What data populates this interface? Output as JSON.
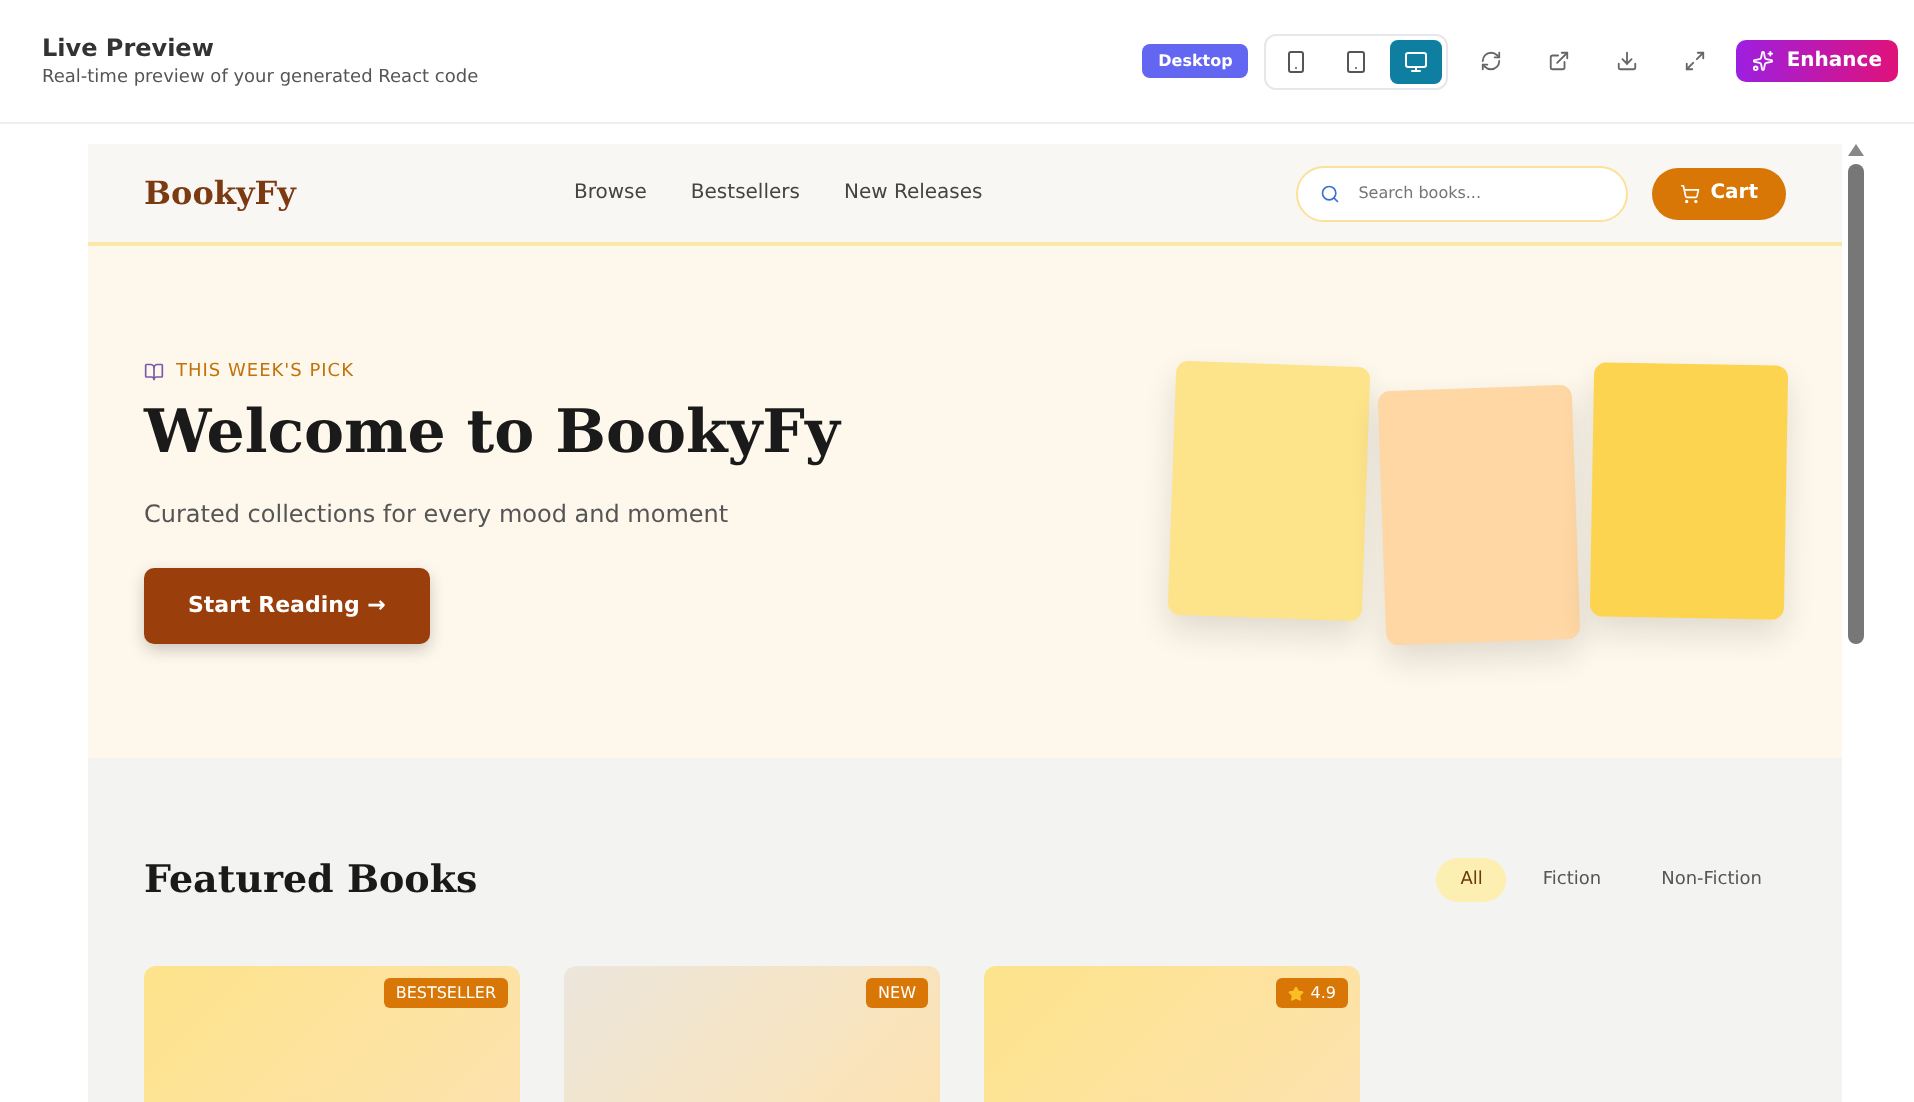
{
  "header": {
    "title": "Live Preview",
    "subtitle": "Real-time preview of your generated React code",
    "device_badge": "Desktop",
    "devices": [
      {
        "kind": "phone",
        "selected": false
      },
      {
        "kind": "tablet",
        "selected": false
      },
      {
        "kind": "desktop",
        "selected": true
      }
    ],
    "enhance_button": "Enhance"
  },
  "site": {
    "logo": "BookyFy",
    "nav": [
      "Browse",
      "Bestsellers",
      "New Releases"
    ],
    "search": {
      "placeholder": "Search books..."
    },
    "cart_button": "Cart",
    "hero": {
      "eyebrow": "THIS WEEK'S PICK",
      "title": "Welcome to BookyFy",
      "subtitle": "Curated collections for every mood and moment",
      "cta": "Start Reading →",
      "covers": [
        {
          "color": "#fde38a"
        },
        {
          "color": "#fed7a4"
        },
        {
          "color": "#fdd44f"
        }
      ]
    },
    "featured": {
      "title": "Featured Books",
      "filters": [
        {
          "label": "All",
          "selected": true
        },
        {
          "label": "Fiction",
          "selected": false
        },
        {
          "label": "Non-Fiction",
          "selected": false
        }
      ],
      "books": [
        {
          "badge": "BESTSELLER",
          "kind": "tag",
          "color": "#fde38a"
        },
        {
          "badge": "NEW",
          "kind": "tag",
          "color": "#ece6dc"
        },
        {
          "badge": "4.9",
          "kind": "rating",
          "color": "#fde38a"
        }
      ]
    }
  }
}
